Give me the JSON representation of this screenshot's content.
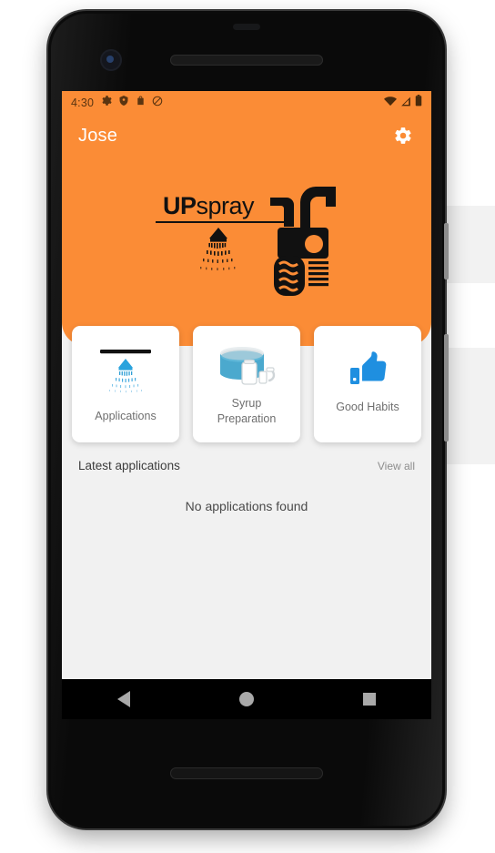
{
  "status_bar": {
    "time": "4:30",
    "left_icons": [
      "gear-icon",
      "shield-icon",
      "bag-icon",
      "do-not-disturb-icon"
    ],
    "right_icons": [
      "wifi-icon",
      "cell-signal-icon",
      "battery-icon"
    ]
  },
  "app_bar": {
    "title": "Jose",
    "settings_icon": "gear-icon"
  },
  "hero": {
    "logo_up": "UP",
    "logo_spray": "spray",
    "logo_mark": "sprayer-tractor-icon",
    "background_color": "#FB8C36"
  },
  "cards": [
    {
      "label": "Applications",
      "icon": "spray-nozzle-icon",
      "icon_color": "#2196e3"
    },
    {
      "label": "Syrup\nPreparation",
      "label_line1": "Syrup",
      "label_line2": "Preparation",
      "icon": "mixing-tank-icon",
      "icon_color": "#4aa8cf"
    },
    {
      "label": "Good Habits",
      "icon": "thumbs-up-icon",
      "icon_color": "#1f8fe0"
    }
  ],
  "latest": {
    "title": "Latest applications",
    "view_all": "View all",
    "empty_message": "No applications found"
  },
  "nav_bar": {
    "back": "back-icon",
    "home": "home-icon",
    "recents": "recents-icon"
  },
  "colors": {
    "accent_orange": "#FB8C36",
    "screen_background": "#F1F1F1",
    "card_background": "#FFFFFF",
    "icon_blue": "#2196E3"
  }
}
